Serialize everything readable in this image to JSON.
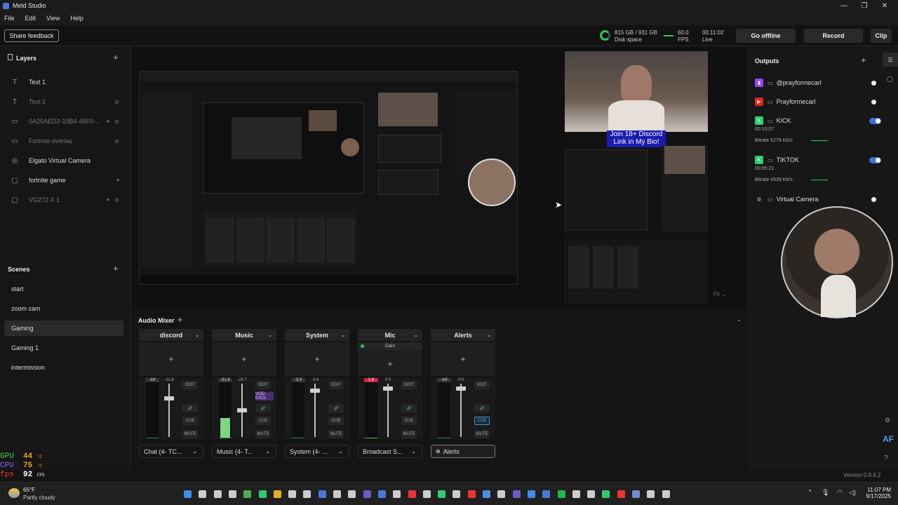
{
  "window": {
    "title": "Meld Studio"
  },
  "menu": [
    "File",
    "Edit",
    "View",
    "Help"
  ],
  "toolbar": {
    "feedback": "Share feedback",
    "disk_value": "815 GB / 931 GB",
    "disk_label": "Disk space",
    "fps_value": "60.0",
    "fps_label": "FPS",
    "time_value": "00:11:02",
    "time_label": "Live",
    "go_offline": "Go offline",
    "record": "Record",
    "clip": "Clip"
  },
  "layers": {
    "title": "Layers",
    "items": [
      {
        "icon": "T",
        "name": "Text 1",
        "dim": false,
        "extra": ""
      },
      {
        "icon": "T",
        "name": "Text 2",
        "dim": true,
        "extra": "eye-off"
      },
      {
        "icon": "▭",
        "name": "0A25AED2-19B4-45F0-...",
        "dim": true,
        "extra": "lock eye-off"
      },
      {
        "icon": "▭",
        "name": "Fortnite overlay",
        "dim": true,
        "extra": "eye-off"
      },
      {
        "icon": "◎",
        "name": "Elgato Virtual Camera",
        "dim": false,
        "extra": ""
      },
      {
        "icon": "▢",
        "name": "fortnite game",
        "dim": false,
        "extra": "lock"
      },
      {
        "icon": "▢",
        "name": "VG272 X 1",
        "dim": true,
        "extra": "lock eye-off"
      }
    ]
  },
  "scenes": {
    "title": "Scenes",
    "items": [
      {
        "name": "start",
        "selected": false
      },
      {
        "name": "zoom cam",
        "selected": false
      },
      {
        "name": "Gaming",
        "selected": true
      },
      {
        "name": "Gaming 1",
        "selected": false
      },
      {
        "name": "intermission",
        "selected": false
      }
    ]
  },
  "preview": {
    "overlay_text": "Join 18+ Discord\nLink in My Bio!",
    "fit_label": "Fit"
  },
  "mixer": {
    "title": "Audio Mixer",
    "channels": [
      {
        "name": "discord",
        "level": "-Inf",
        "gain": "-11.6",
        "fader": 0.75,
        "meter": 0,
        "src": "Chat (4- TC...",
        "selected": false,
        "cue_on": false,
        "vod": false,
        "gain_row": "",
        "red": false
      },
      {
        "name": "Music",
        "level": "-31.8",
        "gain": "-28.7",
        "fader": 0.5,
        "meter": 0.35,
        "src": "Music (4- T...",
        "selected": false,
        "cue_on": false,
        "vod": true,
        "gain_row": "",
        "red": false
      },
      {
        "name": "System",
        "level": "-3.9",
        "gain": "-3.6",
        "fader": 0.9,
        "meter": 0,
        "src": "System (4- ...",
        "selected": false,
        "cue_on": false,
        "vod": false,
        "gain_row": "",
        "red": false
      },
      {
        "name": "Mic",
        "level": "1.6",
        "gain": "0.0",
        "fader": 0.95,
        "meter": 0,
        "src": "Broadcast S...",
        "selected": false,
        "cue_on": false,
        "vod": false,
        "gain_row": "Gain",
        "red": true
      },
      {
        "name": "Alerts",
        "level": "-Inf",
        "gain": "0.0",
        "fader": 0.95,
        "meter": 0,
        "src": "Alerts",
        "selected": true,
        "cue_on": true,
        "vod": false,
        "gain_row": "",
        "red": false
      }
    ],
    "edit": "EDIT",
    "cue": "CUE",
    "mute": "MUTE",
    "vod_label": "VOD-EXCL"
  },
  "outputs": {
    "title": "Outputs",
    "items": [
      {
        "platform": "twitch",
        "name": "@prayformecarl",
        "on": false,
        "time": "",
        "bitrate": ""
      },
      {
        "platform": "youtube",
        "name": "Prayformecarl",
        "on": false,
        "time": "",
        "bitrate": ""
      },
      {
        "platform": "kick",
        "name": "KICK",
        "on": true,
        "time": "00:10:07",
        "bitrate": "Bitrate  5279 Kb/s"
      },
      {
        "platform": "kick",
        "name": "TIKTOK",
        "on": true,
        "time": "00:05:21",
        "bitrate": "Bitrate  4539 Kb/s"
      },
      {
        "platform": "camera",
        "name": "Virtual Camera",
        "on": false,
        "time": "",
        "bitrate": ""
      }
    ]
  },
  "hud": {
    "gpu_label": "GPU",
    "gpu_val": "44",
    "cpu_label": "CPU",
    "cpu_val": "75",
    "fps_label": "fps",
    "fps_val": "92",
    "unit_c": "°C",
    "unit_fps": "FPS"
  },
  "version": "Version 0.9.6.2",
  "taskbar": {
    "temp": "65°F",
    "weather": "Partly cloudy",
    "time": "11:07 PM",
    "date": "9/17/2025"
  },
  "colors": {
    "accent": "#3d6fe0",
    "hud_gpu": "#3fd63f",
    "hud_cpu": "#7b6bff",
    "hud_val": "#f0a020",
    "overlay_bg": "#1b1bb0"
  }
}
